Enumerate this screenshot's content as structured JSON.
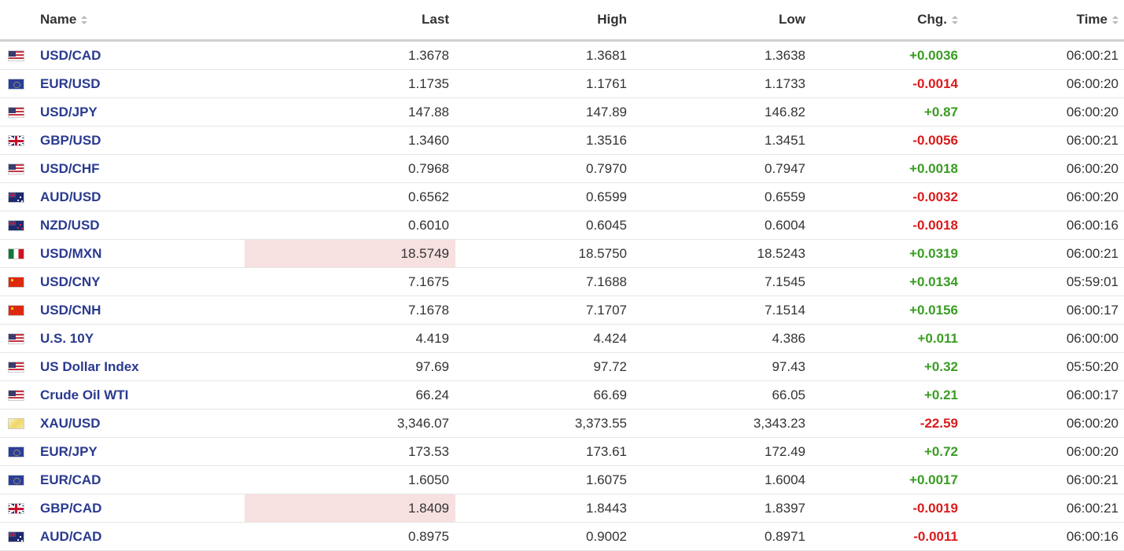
{
  "table": {
    "headers": {
      "name": "Name",
      "last": "Last",
      "high": "High",
      "low": "Low",
      "chg": "Chg.",
      "time": "Time"
    },
    "rows": [
      {
        "flag": "us",
        "name": "USD/CAD",
        "last": "1.3678",
        "high": "1.3681",
        "low": "1.3638",
        "chg": "+0.0036",
        "dir": "up",
        "time": "06:00:21",
        "clock": "green",
        "highlight": false
      },
      {
        "flag": "eu",
        "name": "EUR/USD",
        "last": "1.1735",
        "high": "1.1761",
        "low": "1.1733",
        "chg": "-0.0014",
        "dir": "down",
        "time": "06:00:20",
        "clock": "green",
        "highlight": false
      },
      {
        "flag": "us",
        "name": "USD/JPY",
        "last": "147.88",
        "high": "147.89",
        "low": "146.82",
        "chg": "+0.87",
        "dir": "up",
        "time": "06:00:20",
        "clock": "green",
        "highlight": false
      },
      {
        "flag": "gb",
        "name": "GBP/USD",
        "last": "1.3460",
        "high": "1.3516",
        "low": "1.3451",
        "chg": "-0.0056",
        "dir": "down",
        "time": "06:00:21",
        "clock": "green",
        "highlight": false
      },
      {
        "flag": "us",
        "name": "USD/CHF",
        "last": "0.7968",
        "high": "0.7970",
        "low": "0.7947",
        "chg": "+0.0018",
        "dir": "up",
        "time": "06:00:20",
        "clock": "green",
        "highlight": false
      },
      {
        "flag": "au",
        "name": "AUD/USD",
        "last": "0.6562",
        "high": "0.6599",
        "low": "0.6559",
        "chg": "-0.0032",
        "dir": "down",
        "time": "06:00:20",
        "clock": "green",
        "highlight": false
      },
      {
        "flag": "nz",
        "name": "NZD/USD",
        "last": "0.6010",
        "high": "0.6045",
        "low": "0.6004",
        "chg": "-0.0018",
        "dir": "down",
        "time": "06:00:16",
        "clock": "green",
        "highlight": false
      },
      {
        "flag": "mx",
        "name": "USD/MXN",
        "last": "18.5749",
        "high": "18.5750",
        "low": "18.5243",
        "chg": "+0.0319",
        "dir": "up",
        "time": "06:00:21",
        "clock": "green",
        "highlight": true
      },
      {
        "flag": "cn",
        "name": "USD/CNY",
        "last": "7.1675",
        "high": "7.1688",
        "low": "7.1545",
        "chg": "+0.0134",
        "dir": "up",
        "time": "05:59:01",
        "clock": "green",
        "highlight": false
      },
      {
        "flag": "cn",
        "name": "USD/CNH",
        "last": "7.1678",
        "high": "7.1707",
        "low": "7.1514",
        "chg": "+0.0156",
        "dir": "up",
        "time": "06:00:17",
        "clock": "green",
        "highlight": false
      },
      {
        "flag": "us",
        "name": "U.S. 10Y",
        "last": "4.419",
        "high": "4.424",
        "low": "4.386",
        "chg": "+0.011",
        "dir": "up",
        "time": "06:00:00",
        "clock": "red",
        "highlight": false
      },
      {
        "flag": "us",
        "name": "US Dollar Index",
        "last": "97.69",
        "high": "97.72",
        "low": "97.43",
        "chg": "+0.32",
        "dir": "up",
        "time": "05:50:20",
        "clock": "red",
        "highlight": false
      },
      {
        "flag": "us",
        "name": "Crude Oil WTI",
        "last": "66.24",
        "high": "66.69",
        "low": "66.05",
        "chg": "+0.21",
        "dir": "up",
        "time": "06:00:17",
        "clock": "green",
        "highlight": false
      },
      {
        "flag": "xau",
        "name": "XAU/USD",
        "last": "3,346.07",
        "high": "3,373.55",
        "low": "3,343.23",
        "chg": "-22.59",
        "dir": "down",
        "time": "06:00:20",
        "clock": "green",
        "highlight": false
      },
      {
        "flag": "eu",
        "name": "EUR/JPY",
        "last": "173.53",
        "high": "173.61",
        "low": "172.49",
        "chg": "+0.72",
        "dir": "up",
        "time": "06:00:20",
        "clock": "green",
        "highlight": false
      },
      {
        "flag": "eu",
        "name": "EUR/CAD",
        "last": "1.6050",
        "high": "1.6075",
        "low": "1.6004",
        "chg": "+0.0017",
        "dir": "up",
        "time": "06:00:21",
        "clock": "green",
        "highlight": false
      },
      {
        "flag": "gb",
        "name": "GBP/CAD",
        "last": "1.8409",
        "high": "1.8443",
        "low": "1.8397",
        "chg": "-0.0019",
        "dir": "down",
        "time": "06:00:21",
        "clock": "green",
        "highlight": true
      },
      {
        "flag": "au",
        "name": "AUD/CAD",
        "last": "0.8975",
        "high": "0.9002",
        "low": "0.8971",
        "chg": "-0.0011",
        "dir": "down",
        "time": "06:00:16",
        "clock": "green",
        "highlight": false
      }
    ]
  },
  "colors": {
    "link": "#2a3a8f",
    "up": "#3a9d23",
    "down": "#d91b1b",
    "highlight": "#f7e0e0"
  }
}
